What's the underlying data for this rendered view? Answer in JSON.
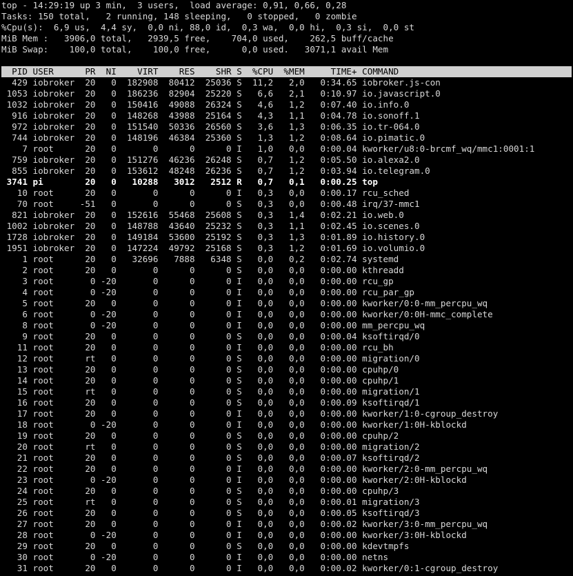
{
  "summary": [
    "top - 14:29:19 up 3 min,  3 users,  load average: 0,91, 0,66, 0,28",
    "Tasks: 150 total,   2 running, 148 sleeping,   0 stopped,   0 zombie",
    "%Cpu(s):  6,9 us,  4,4 sy,  0,0 ni, 88,0 id,  0,3 wa,  0,0 hi,  0,3 si,  0,0 st",
    "MiB Mem :   3906,0 total,   2939,5 free,    704,0 used,    262,5 buff/cache",
    "MiB Swap:    100,0 total,    100,0 free,      0,0 used.   3071,1 avail Mem"
  ],
  "header_line": "  PID USER      PR  NI    VIRT    RES    SHR S  %CPU  %MEM     TIME+ COMMAND",
  "process_lines": [
    "  429 iobroker  20   0  182908  80412  25036 S  11,2   2,0   0:34.65 iobroker.js-con",
    " 1053 iobroker  20   0  186236  82904  25220 S   6,6   2,1   0:10.97 io.javascript.0",
    " 1032 iobroker  20   0  150416  49088  26324 S   4,6   1,2   0:07.40 io.info.0",
    "  916 iobroker  20   0  148268  43988  25164 S   4,3   1,1   0:04.78 io.sonoff.1",
    "  972 iobroker  20   0  151540  50336  26560 S   3,6   1,3   0:06.35 io.tr-064.0",
    "  744 iobroker  20   0  148196  46384  25360 S   1,3   1,2   0:08.64 io.pimatic.0",
    "    7 root      20   0       0      0      0 I   1,0   0,0   0:00.04 kworker/u8:0-brcmf_wq/mmc1:0001:1",
    "  759 iobroker  20   0  151276  46236  26248 S   0,7   1,2   0:05.50 io.alexa2.0",
    "  855 iobroker  20   0  153612  48248  26236 S   0,7   1,2   0:03.94 io.telegram.0",
    " 3741 pi        20   0   10288   3012   2512 R   0,7   0,1   0:00.25 top",
    "   10 root      20   0       0      0      0 I   0,3   0,0   0:00.17 rcu_sched",
    "   70 root     -51   0       0      0      0 S   0,3   0,0   0:00.48 irq/37-mmc1",
    "  821 iobroker  20   0  152616  55468  25608 S   0,3   1,4   0:02.21 io.web.0",
    " 1002 iobroker  20   0  148788  43640  25232 S   0,3   1,1   0:02.45 io.scenes.0",
    " 1728 iobroker  20   0  149184  53600  25192 S   0,3   1,3   0:01.89 io.history.0",
    " 1951 iobroker  20   0  147224  49792  25168 S   0,3   1,2   0:01.69 io.volumio.0",
    "    1 root      20   0   32696   7888   6348 S   0,0   0,2   0:02.74 systemd",
    "    2 root      20   0       0      0      0 S   0,0   0,0   0:00.00 kthreadd",
    "    3 root       0 -20       0      0      0 I   0,0   0,0   0:00.00 rcu_gp",
    "    4 root       0 -20       0      0      0 I   0,0   0,0   0:00.00 rcu_par_gp",
    "    5 root      20   0       0      0      0 I   0,0   0,0   0:00.00 kworker/0:0-mm_percpu_wq",
    "    6 root       0 -20       0      0      0 I   0,0   0,0   0:00.00 kworker/0:0H-mmc_complete",
    "    8 root       0 -20       0      0      0 I   0,0   0,0   0:00.00 mm_percpu_wq",
    "    9 root      20   0       0      0      0 S   0,0   0,0   0:00.04 ksoftirqd/0",
    "   11 root      20   0       0      0      0 I   0,0   0,0   0:00.00 rcu_bh",
    "   12 root      rt   0       0      0      0 S   0,0   0,0   0:00.00 migration/0",
    "   13 root      20   0       0      0      0 S   0,0   0,0   0:00.00 cpuhp/0",
    "   14 root      20   0       0      0      0 S   0,0   0,0   0:00.00 cpuhp/1",
    "   15 root      rt   0       0      0      0 S   0,0   0,0   0:00.00 migration/1",
    "   16 root      20   0       0      0      0 S   0,0   0,0   0:00.09 ksoftirqd/1",
    "   17 root      20   0       0      0      0 I   0,0   0,0   0:00.00 kworker/1:0-cgroup_destroy",
    "   18 root       0 -20       0      0      0 I   0,0   0,0   0:00.00 kworker/1:0H-kblockd",
    "   19 root      20   0       0      0      0 S   0,0   0,0   0:00.00 cpuhp/2",
    "   20 root      rt   0       0      0      0 S   0,0   0,0   0:00.00 migration/2",
    "   21 root      20   0       0      0      0 S   0,0   0,0   0:00.07 ksoftirqd/2",
    "   22 root      20   0       0      0      0 I   0,0   0,0   0:00.00 kworker/2:0-mm_percpu_wq",
    "   23 root       0 -20       0      0      0 I   0,0   0,0   0:00.00 kworker/2:0H-kblockd",
    "   24 root      20   0       0      0      0 S   0,0   0,0   0:00.00 cpuhp/3",
    "   25 root      rt   0       0      0      0 S   0,0   0,0   0:00.01 migration/3",
    "   26 root      20   0       0      0      0 S   0,0   0,0   0:00.05 ksoftirqd/3",
    "   27 root      20   0       0      0      0 I   0,0   0,0   0:00.02 kworker/3:0-mm_percpu_wq",
    "   28 root       0 -20       0      0      0 I   0,0   0,0   0:00.00 kworker/3:0H-kblockd",
    "   29 root      20   0       0      0      0 S   0,0   0,0   0:00.00 kdevtmpfs",
    "   30 root       0 -20       0      0      0 I   0,0   0,0   0:00.00 netns",
    "   31 root      20   0       0      0      0 I   0,0   0,0   0:00.02 kworker/0:1-cgroup_destroy"
  ],
  "highlighted_row": 9,
  "colors": {
    "background": "#000000",
    "text": "#d8d8d8",
    "header_bg": "#d0d0d0",
    "header_text": "#000000",
    "running_text": "#ffffff"
  }
}
